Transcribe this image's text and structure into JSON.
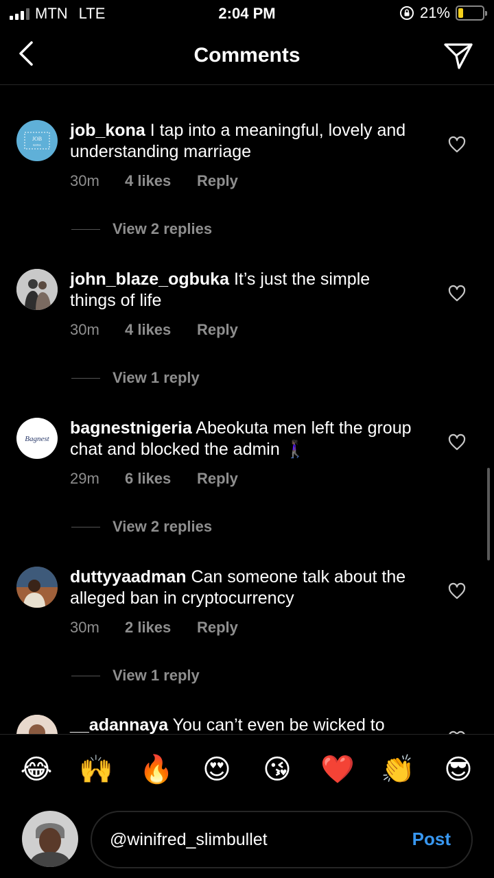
{
  "status_bar": {
    "carrier": "MTN",
    "network": "LTE",
    "time": "2:04 PM",
    "battery_percent": "21%",
    "battery_level": 0.21
  },
  "header": {
    "title": "Comments",
    "back_icon": "chevron-left-icon",
    "share_icon": "paper-plane-icon"
  },
  "comments": [
    {
      "username": "job_kona",
      "text": "I tap into a meaningful, lovely and understanding marriage",
      "time": "30m",
      "likes": "4 likes",
      "reply": "Reply",
      "view_replies": "View 2 replies",
      "avatar_text": "JOB KONA"
    },
    {
      "username": "john_blaze_ogbuka",
      "text": "It’s just the simple things of life",
      "time": "30m",
      "likes": "4 likes",
      "reply": "Reply",
      "view_replies": "View 1 reply"
    },
    {
      "username": "bagnestnigeria",
      "text": "Abeokuta men left the group chat and blocked the admin 🚶🏿‍♀️",
      "time": "29m",
      "likes": "6 likes",
      "reply": "Reply",
      "view_replies": "View 2 replies",
      "avatar_text": "Bagnest"
    },
    {
      "username": "duttyyaadman",
      "text": "Can someone talk about the alleged ban in cryptocurrency",
      "time": "30m",
      "likes": "2 likes",
      "reply": "Reply",
      "view_replies": "View 1 reply"
    },
    {
      "username": "__adannaya",
      "text": "You can’t even be wicked to"
    }
  ],
  "emoji_bar": [
    "😂",
    "🙌",
    "🔥",
    "😍",
    "😘",
    "❤️",
    "👏",
    "😎"
  ],
  "composer": {
    "input_value": "@winifred_slimbullet",
    "post_label": "Post"
  },
  "colors": {
    "background": "#000000",
    "secondary_text": "#8e8e8e",
    "post_blue": "#3897f0",
    "battery_yellow": "#f5d01c"
  }
}
